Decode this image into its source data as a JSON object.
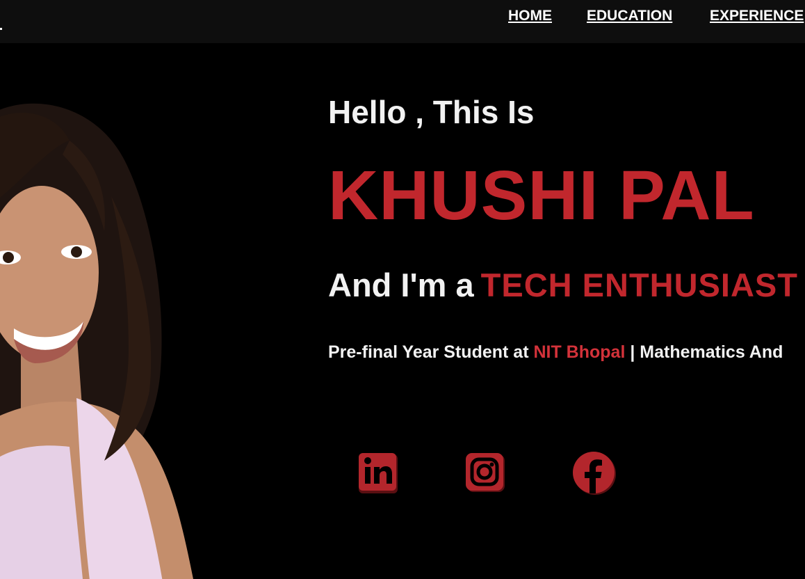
{
  "nav": {
    "items": [
      {
        "label": "HOME"
      },
      {
        "label": "EDUCATION"
      },
      {
        "label": "EXPERIENCE"
      }
    ]
  },
  "hero": {
    "greeting": "Hello , This Is",
    "name": "KHUSHI PAL",
    "role_prefix": "And I'm a",
    "role": "TECH ENTHUSIAST",
    "tagline_prefix": "Pre-final Year Student at",
    "tagline_highlight": "NIT Bhopal",
    "tagline_suffix": "| Mathematics And"
  },
  "social": {
    "icons": [
      "linkedin-icon",
      "instagram-icon",
      "facebook-icon"
    ]
  },
  "colors": {
    "accent": "#c1272d",
    "background": "#000000",
    "navbar": "#0e0e0e",
    "text": "#f2f2f2"
  }
}
